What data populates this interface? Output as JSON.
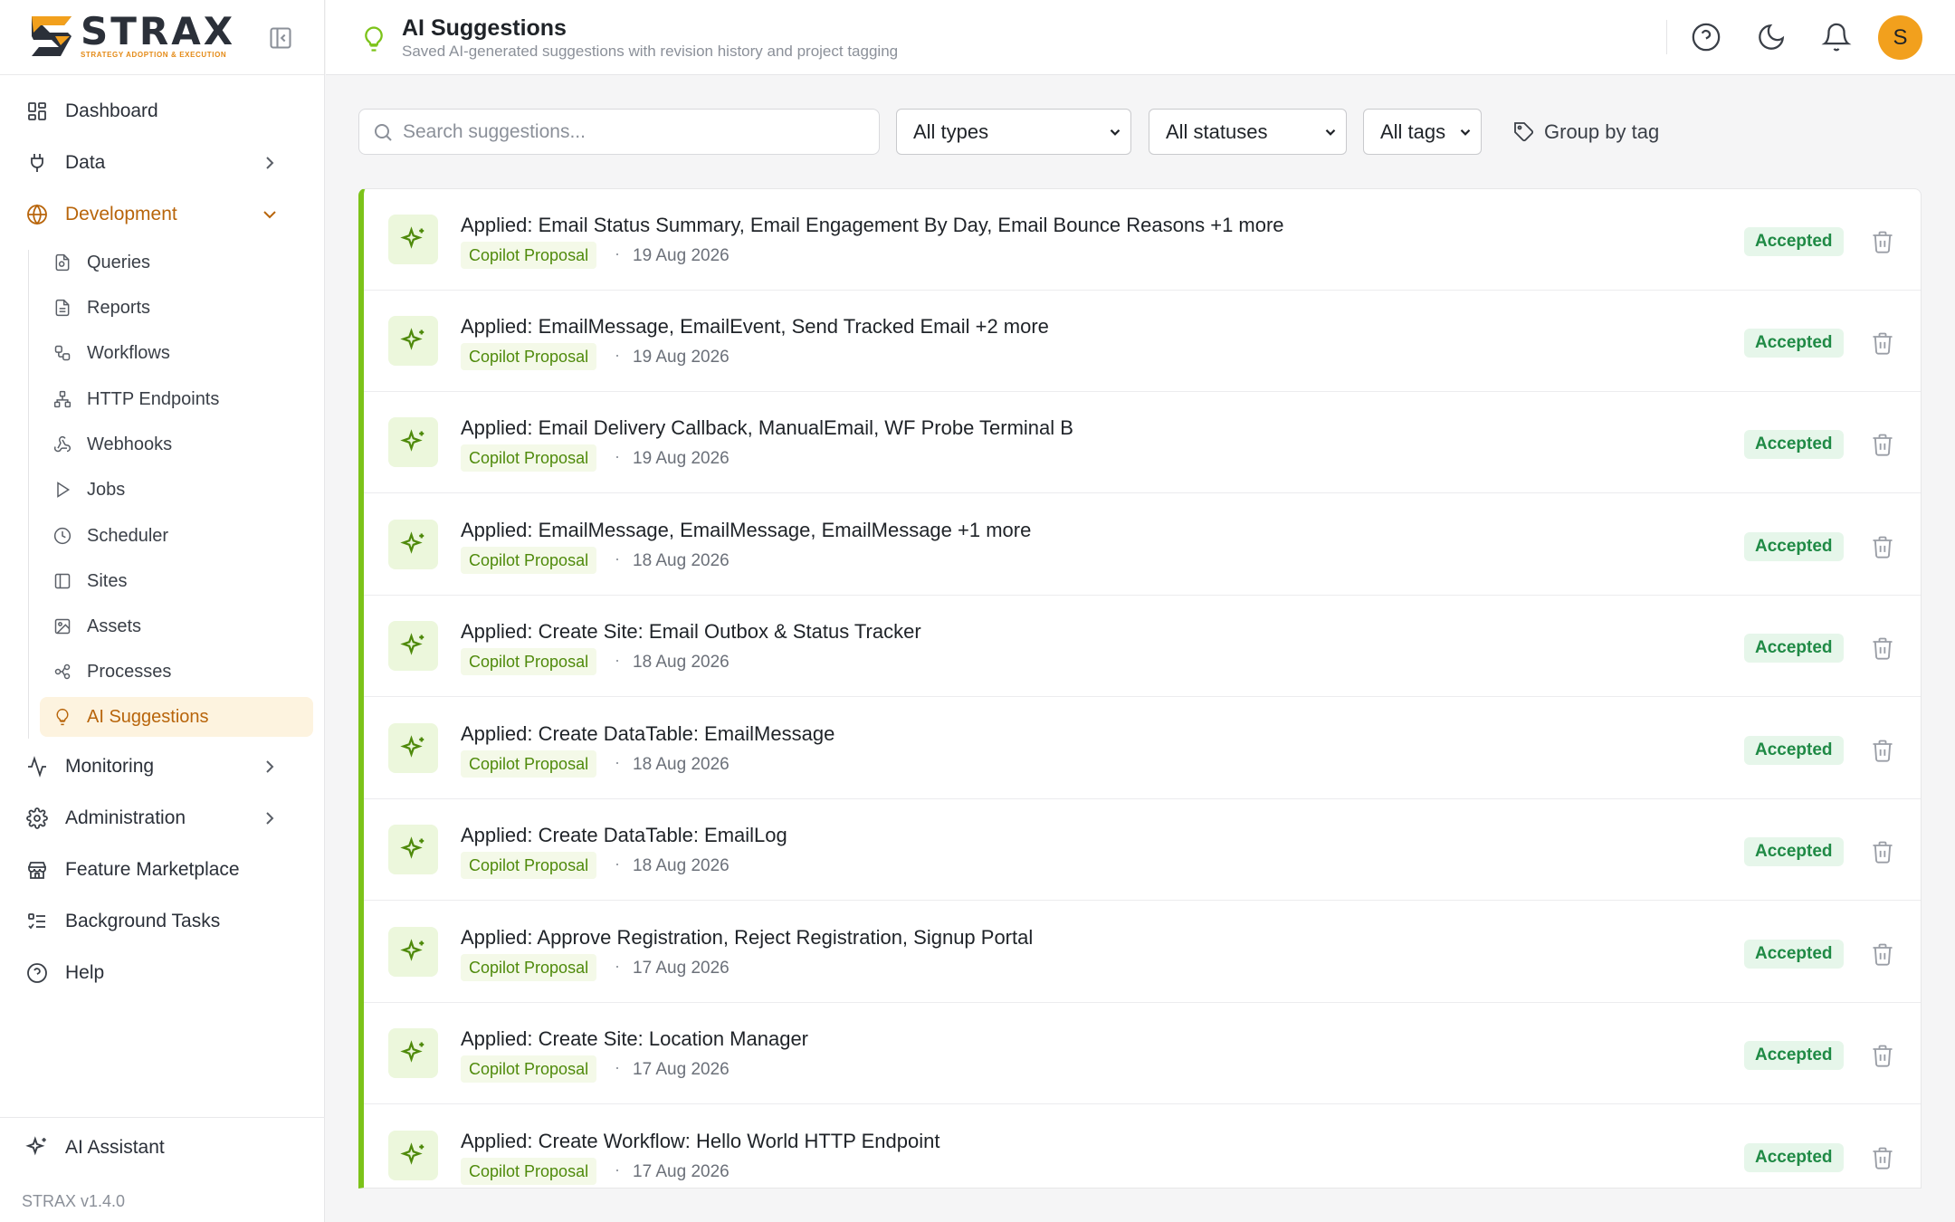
{
  "brand": {
    "name": "STRAX",
    "tagline": "STRATEGY ADOPTION & EXECUTION",
    "accent": "#f2a01d",
    "dark": "#2b3039"
  },
  "sidebar": {
    "items": [
      {
        "label": "Dashboard",
        "icon": "dashboard-icon"
      },
      {
        "label": "Data",
        "icon": "plug-icon"
      },
      {
        "label": "Development",
        "icon": "globe-icon"
      },
      {
        "label": "Monitoring",
        "icon": "activity-icon"
      },
      {
        "label": "Administration",
        "icon": "gear-icon"
      },
      {
        "label": "Feature Marketplace",
        "icon": "store-icon"
      },
      {
        "label": "Background Tasks",
        "icon": "tasks-icon"
      },
      {
        "label": "Help",
        "icon": "help-icon"
      }
    ],
    "sub_items": [
      {
        "label": "Queries",
        "icon": "query-file-icon"
      },
      {
        "label": "Reports",
        "icon": "report-file-icon"
      },
      {
        "label": "Workflows",
        "icon": "workflow-icon"
      },
      {
        "label": "HTTP Endpoints",
        "icon": "network-icon"
      },
      {
        "label": "Webhooks",
        "icon": "webhook-icon"
      },
      {
        "label": "Jobs",
        "icon": "play-icon"
      },
      {
        "label": "Scheduler",
        "icon": "clock-icon"
      },
      {
        "label": "Sites",
        "icon": "panel-icon"
      },
      {
        "label": "Assets",
        "icon": "image-icon"
      },
      {
        "label": "Processes",
        "icon": "process-icon"
      },
      {
        "label": "AI Suggestions",
        "icon": "lightbulb-icon"
      }
    ],
    "ai_assistant": "AI Assistant",
    "version": "STRAX v1.4.0"
  },
  "header": {
    "title": "AI Suggestions",
    "subtitle": "Saved AI-generated suggestions with revision history and project tagging"
  },
  "user": {
    "initial": "S"
  },
  "toolbar": {
    "search_placeholder": "Search suggestions...",
    "type_filter": "All types",
    "status_filter": "All statuses",
    "tag_filter": "All tags",
    "group_by": "Group by tag"
  },
  "suggestions": [
    {
      "title": "Applied: Email Status Summary, Email Engagement By Day, Email Bounce Reasons +1 more",
      "tag": "Copilot Proposal",
      "date": "19 Aug 2026",
      "status": "Accepted"
    },
    {
      "title": "Applied: EmailMessage, EmailEvent, Send Tracked Email +2 more",
      "tag": "Copilot Proposal",
      "date": "19 Aug 2026",
      "status": "Accepted"
    },
    {
      "title": "Applied: Email Delivery Callback, ManualEmail, WF Probe Terminal B",
      "tag": "Copilot Proposal",
      "date": "19 Aug 2026",
      "status": "Accepted"
    },
    {
      "title": "Applied: EmailMessage, EmailMessage, EmailMessage +1 more",
      "tag": "Copilot Proposal",
      "date": "18 Aug 2026",
      "status": "Accepted"
    },
    {
      "title": "Applied: Create Site: Email Outbox & Status Tracker",
      "tag": "Copilot Proposal",
      "date": "18 Aug 2026",
      "status": "Accepted"
    },
    {
      "title": "Applied: Create DataTable: EmailMessage",
      "tag": "Copilot Proposal",
      "date": "18 Aug 2026",
      "status": "Accepted"
    },
    {
      "title": "Applied: Create DataTable: EmailLog",
      "tag": "Copilot Proposal",
      "date": "18 Aug 2026",
      "status": "Accepted"
    },
    {
      "title": "Applied: Approve Registration, Reject Registration, Signup Portal",
      "tag": "Copilot Proposal",
      "date": "17 Aug 2026",
      "status": "Accepted"
    },
    {
      "title": "Applied: Create Site: Location Manager",
      "tag": "Copilot Proposal",
      "date": "17 Aug 2026",
      "status": "Accepted"
    },
    {
      "title": "Applied: Create Workflow: Hello World HTTP Endpoint",
      "tag": "Copilot Proposal",
      "date": "17 Aug 2026",
      "status": "Accepted"
    }
  ],
  "colors": {
    "active_nav": "#b8650b",
    "active_bg": "#fdf3df",
    "accepted_text": "#1f8a45",
    "accepted_bg": "#e6f6ea",
    "tag_text": "#4f8a0b",
    "list_accent": "#7cc319"
  }
}
